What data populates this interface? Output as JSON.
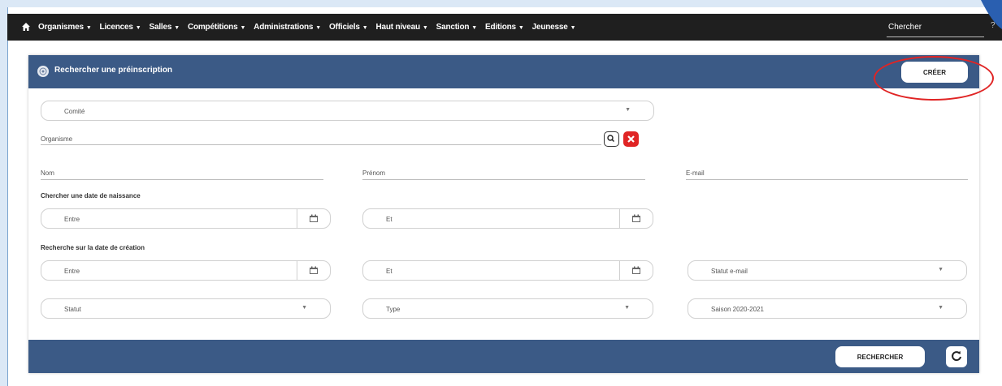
{
  "nav": {
    "items": [
      "Organismes",
      "Licences",
      "Salles",
      "Compétitions",
      "Administrations",
      "Officiels",
      "Haut niveau",
      "Sanction",
      "Editions",
      "Jeunesse"
    ],
    "search": "Chercher",
    "help": "?"
  },
  "panel": {
    "title": "Rechercher une préinscription",
    "create_label": "CRÉER"
  },
  "form": {
    "comite": "Comité",
    "organisme": "Organisme",
    "nom": "Nom",
    "prenom": "Prénom",
    "email": "E-mail",
    "birth_label": "Chercher une date de naissance",
    "birth_from": "Entre",
    "birth_to": "Et",
    "creation_label": "Recherche sur la date de création",
    "creation_from": "Entre",
    "creation_to": "Et",
    "statut_email": "Statut e-mail",
    "statut": "Statut",
    "type": "Type",
    "saison": "Saison 2020-2021"
  },
  "footer": {
    "search_label": "RECHERCHER"
  },
  "colors": {
    "header": "#3b5a86",
    "nav": "#1f1f1f",
    "accent_red": "#e02424"
  }
}
